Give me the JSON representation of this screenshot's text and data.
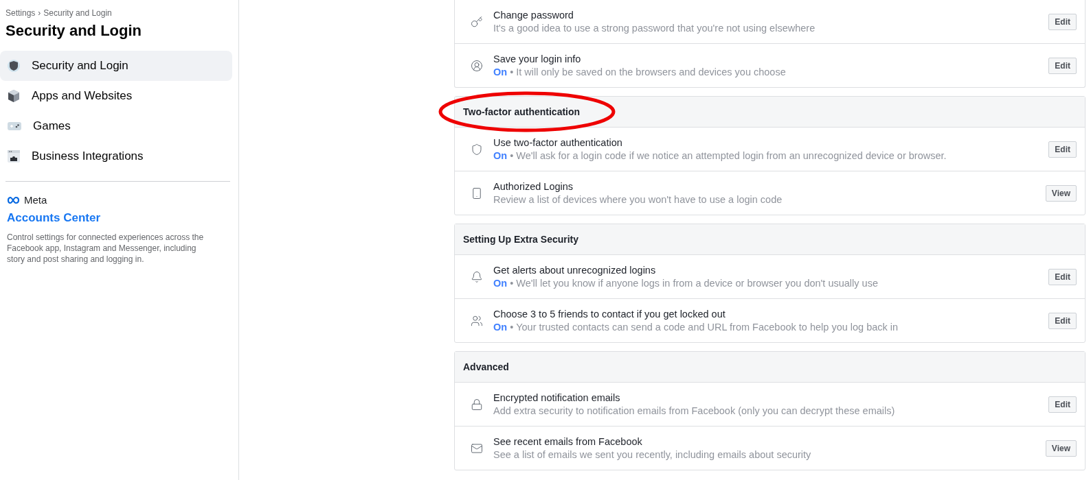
{
  "sidebar": {
    "breadcrumb": [
      {
        "label": "Settings"
      },
      {
        "label": "Security and Login"
      }
    ],
    "breadcrumb_separator": "›",
    "title": "Security and Login",
    "items": [
      {
        "label": "Security and Login",
        "selected": true
      },
      {
        "label": "Apps and Websites",
        "selected": false
      },
      {
        "label": "Games",
        "selected": false
      },
      {
        "label": "Business Integrations",
        "selected": false
      }
    ],
    "meta_label": "Meta",
    "accounts_center": {
      "title": "Accounts Center",
      "description": "Control settings for connected experiences across the Facebook app, Instagram and Messenger, including story and post sharing and logging in."
    }
  },
  "sections": [
    {
      "rows": [
        {
          "title": "Change password",
          "description": "It's a good idea to use a strong password that you're not using elsewhere",
          "button": "Edit"
        },
        {
          "title": "Save your login info",
          "status": "On",
          "description": "It will only be saved on the browsers and devices you choose",
          "button": "Edit"
        }
      ]
    },
    {
      "header": "Two-factor authentication",
      "highlighted": true,
      "rows": [
        {
          "title": "Use two-factor authentication",
          "status": "On",
          "description": "We'll ask for a login code if we notice an attempted login from an unrecognized device or browser.",
          "button": "Edit"
        },
        {
          "title": "Authorized Logins",
          "description": "Review a list of devices where you won't have to use a login code",
          "button": "View"
        }
      ]
    },
    {
      "header": "Setting Up Extra Security",
      "highlighted": false,
      "rows": [
        {
          "title": "Get alerts about unrecognized logins",
          "status": "On",
          "description": "We'll let you know if anyone logs in from a device or browser you don't usually use",
          "button": "Edit"
        },
        {
          "title": "Choose 3 to 5 friends to contact if you get locked out",
          "status": "On",
          "description": "Your trusted contacts can send a code and URL from Facebook to help you log back in",
          "button": "Edit"
        }
      ]
    },
    {
      "header": "Advanced",
      "highlighted": false,
      "rows": [
        {
          "title": "Encrypted notification emails",
          "description": "Add extra security to notification emails from Facebook (only you can decrypt these emails)",
          "button": "Edit"
        },
        {
          "title": "See recent emails from Facebook",
          "description": "See a list of emails we sent you recently, including emails about security",
          "button": "View"
        }
      ]
    }
  ],
  "status_separator": "•"
}
